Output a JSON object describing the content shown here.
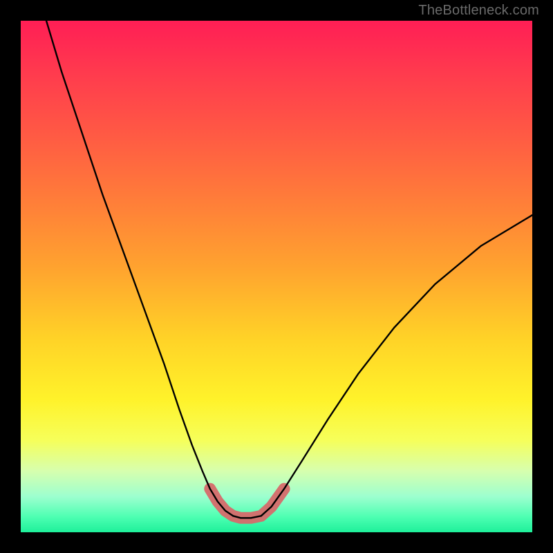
{
  "watermark": "TheBottleneck.com",
  "chart_data": {
    "type": "line",
    "title": "",
    "xlabel": "",
    "ylabel": "",
    "xlim": [
      0,
      100
    ],
    "ylim": [
      0,
      100
    ],
    "background_gradient": {
      "top": "#ff1e55",
      "mid": "#ffd227",
      "bottom": "#1ef09a"
    },
    "series": [
      {
        "name": "left-branch",
        "x": [
          5,
          8,
          12,
          16,
          20,
          24,
          28,
          31,
          33.5,
          35.5,
          37,
          38.5,
          40,
          41.5
        ],
        "y": [
          100,
          90,
          78,
          66,
          55,
          44,
          33,
          24,
          17,
          12,
          8.5,
          6,
          4.2,
          3.2
        ]
      },
      {
        "name": "right-branch",
        "x": [
          47,
          49,
          51.5,
          55,
          60,
          66,
          73,
          81,
          90,
          100
        ],
        "y": [
          3.2,
          5,
          8.5,
          14,
          22,
          31,
          40,
          48.5,
          56,
          62
        ]
      },
      {
        "name": "valley-floor",
        "x": [
          41.5,
          43,
          45,
          47
        ],
        "y": [
          3.2,
          2.8,
          2.8,
          3.2
        ]
      }
    ],
    "highlight_region": {
      "name": "optimal-zone",
      "x": [
        37,
        38.5,
        40,
        41.5,
        43,
        45,
        47,
        49,
        51.5
      ],
      "y": [
        8.5,
        6,
        4.2,
        3.2,
        2.8,
        2.8,
        3.2,
        5,
        8.5
      ],
      "color": "#d66a6a"
    }
  }
}
